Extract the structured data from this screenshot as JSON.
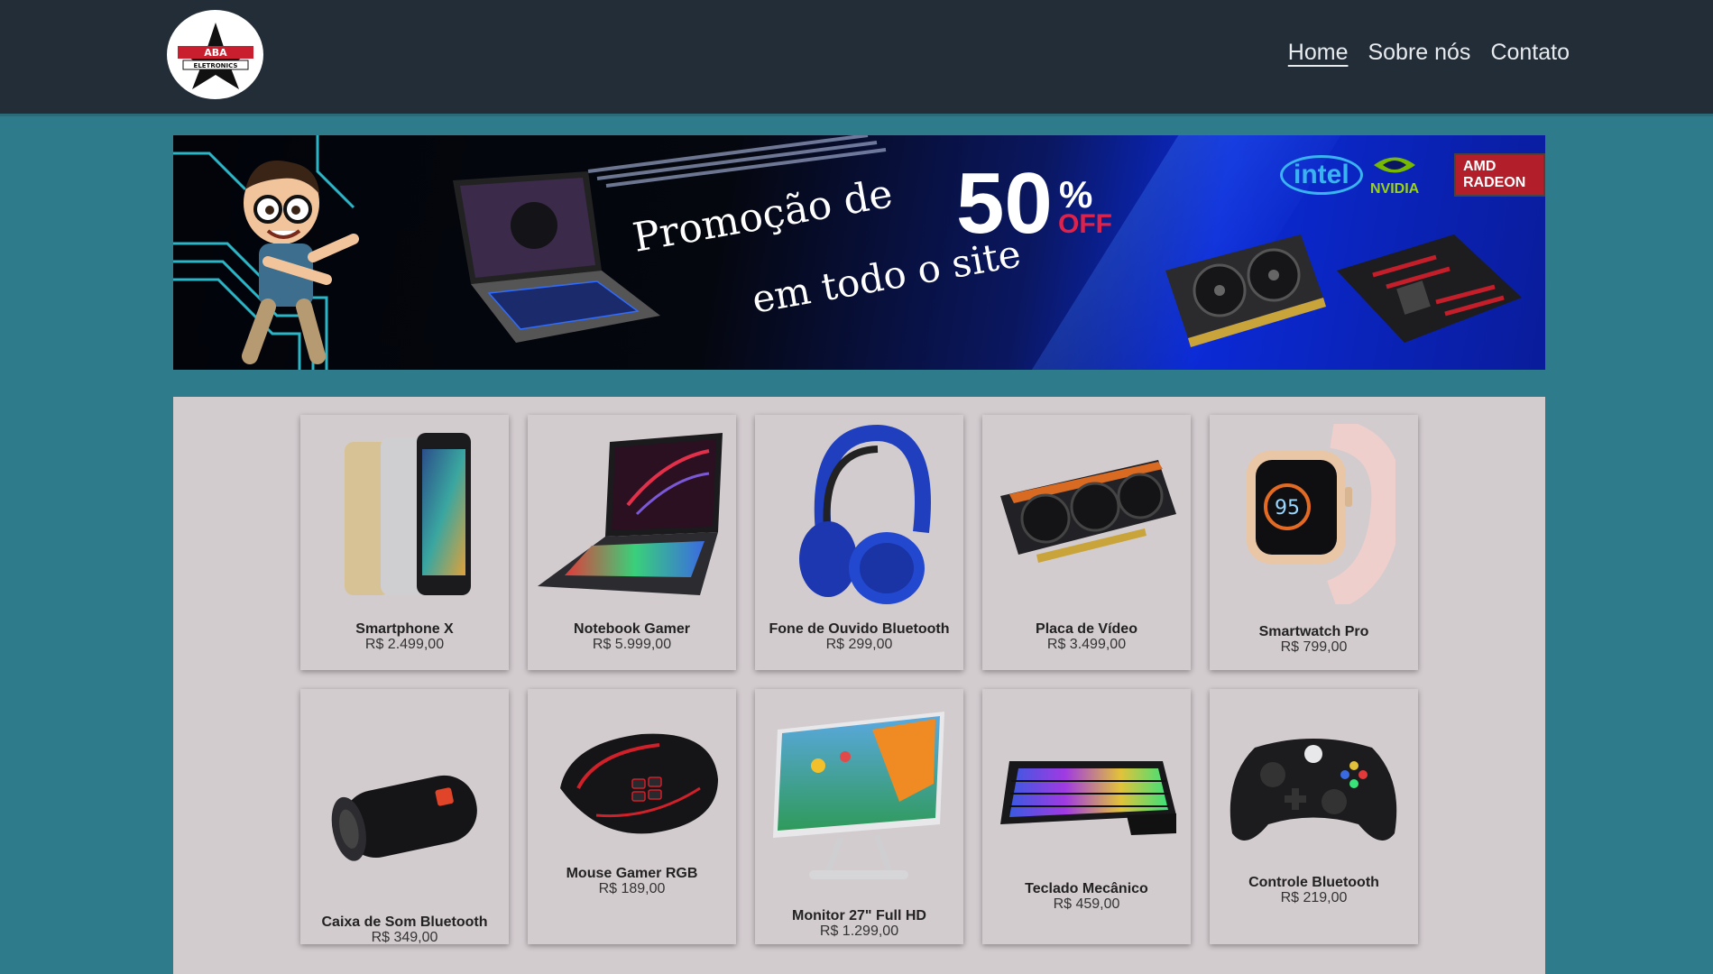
{
  "header": {
    "logo_text": "ABA ELETRONICS",
    "nav": [
      {
        "label": "Home",
        "active": true
      },
      {
        "label": "Sobre nós",
        "active": false
      },
      {
        "label": "Contato",
        "active": false
      }
    ]
  },
  "banner": {
    "line1": "Promoção de",
    "line2": "em todo o site",
    "discount": "50",
    "percent": "%",
    "off": "OFF",
    "brands": {
      "intel": "intel",
      "nvidia": "NVIDIA",
      "amd": "AMD RADEON"
    }
  },
  "products": [
    {
      "name": "Smartphone X",
      "price": "R$ 2.499,00",
      "icon": "smartphone-icon"
    },
    {
      "name": "Notebook Gamer",
      "price": "R$ 5.999,00",
      "icon": "laptop-icon"
    },
    {
      "name": "Fone de Ouvido Bluetooth",
      "price": "R$ 299,00",
      "icon": "headphones-icon"
    },
    {
      "name": "Placa de Vídeo",
      "price": "R$ 3.499,00",
      "icon": "gpu-icon"
    },
    {
      "name": "Smartwatch Pro",
      "price": "R$ 799,00",
      "icon": "smartwatch-icon"
    },
    {
      "name": "Caixa de Som Bluetooth",
      "price": "R$ 349,00",
      "icon": "speaker-icon"
    },
    {
      "name": "Mouse Gamer RGB",
      "price": "R$ 189,00",
      "icon": "mouse-icon"
    },
    {
      "name": "Monitor 27\" Full HD",
      "price": "R$ 1.299,00",
      "icon": "monitor-icon"
    },
    {
      "name": "Teclado Mecânico",
      "price": "R$ 459,00",
      "icon": "keyboard-icon"
    },
    {
      "name": "Controle Bluetooth",
      "price": "R$ 219,00",
      "icon": "gamepad-icon"
    }
  ],
  "colors": {
    "header_bg": "#222d38",
    "page_bg": "#2e7b8c",
    "panel_bg": "#d3cccf",
    "accent_red": "#e0224a"
  }
}
